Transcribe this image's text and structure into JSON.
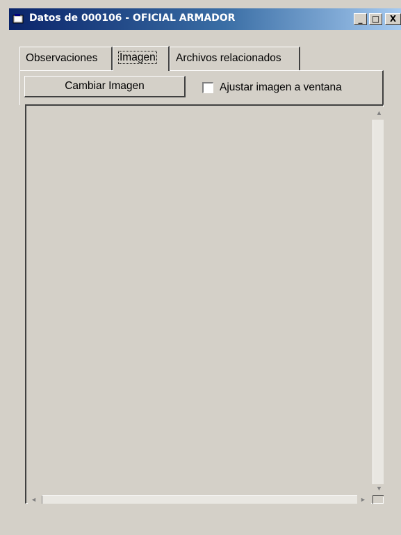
{
  "window": {
    "title": "Datos de 000106 - OFICIAL ARMADOR",
    "minimize_glyph": "_",
    "maximize_glyph": "□",
    "close_glyph": "X"
  },
  "tabs": [
    {
      "label": "Observaciones"
    },
    {
      "label": "Imagen"
    },
    {
      "label": "Archivos relacionados"
    }
  ],
  "toolbar": {
    "change_image_label": "Cambiar Imagen",
    "fit_checkbox_label": "Ajustar imagen a ventana",
    "fit_checked": false
  },
  "scroll": {
    "up": "▲",
    "down": "▼",
    "left": "◄",
    "right": "►"
  }
}
